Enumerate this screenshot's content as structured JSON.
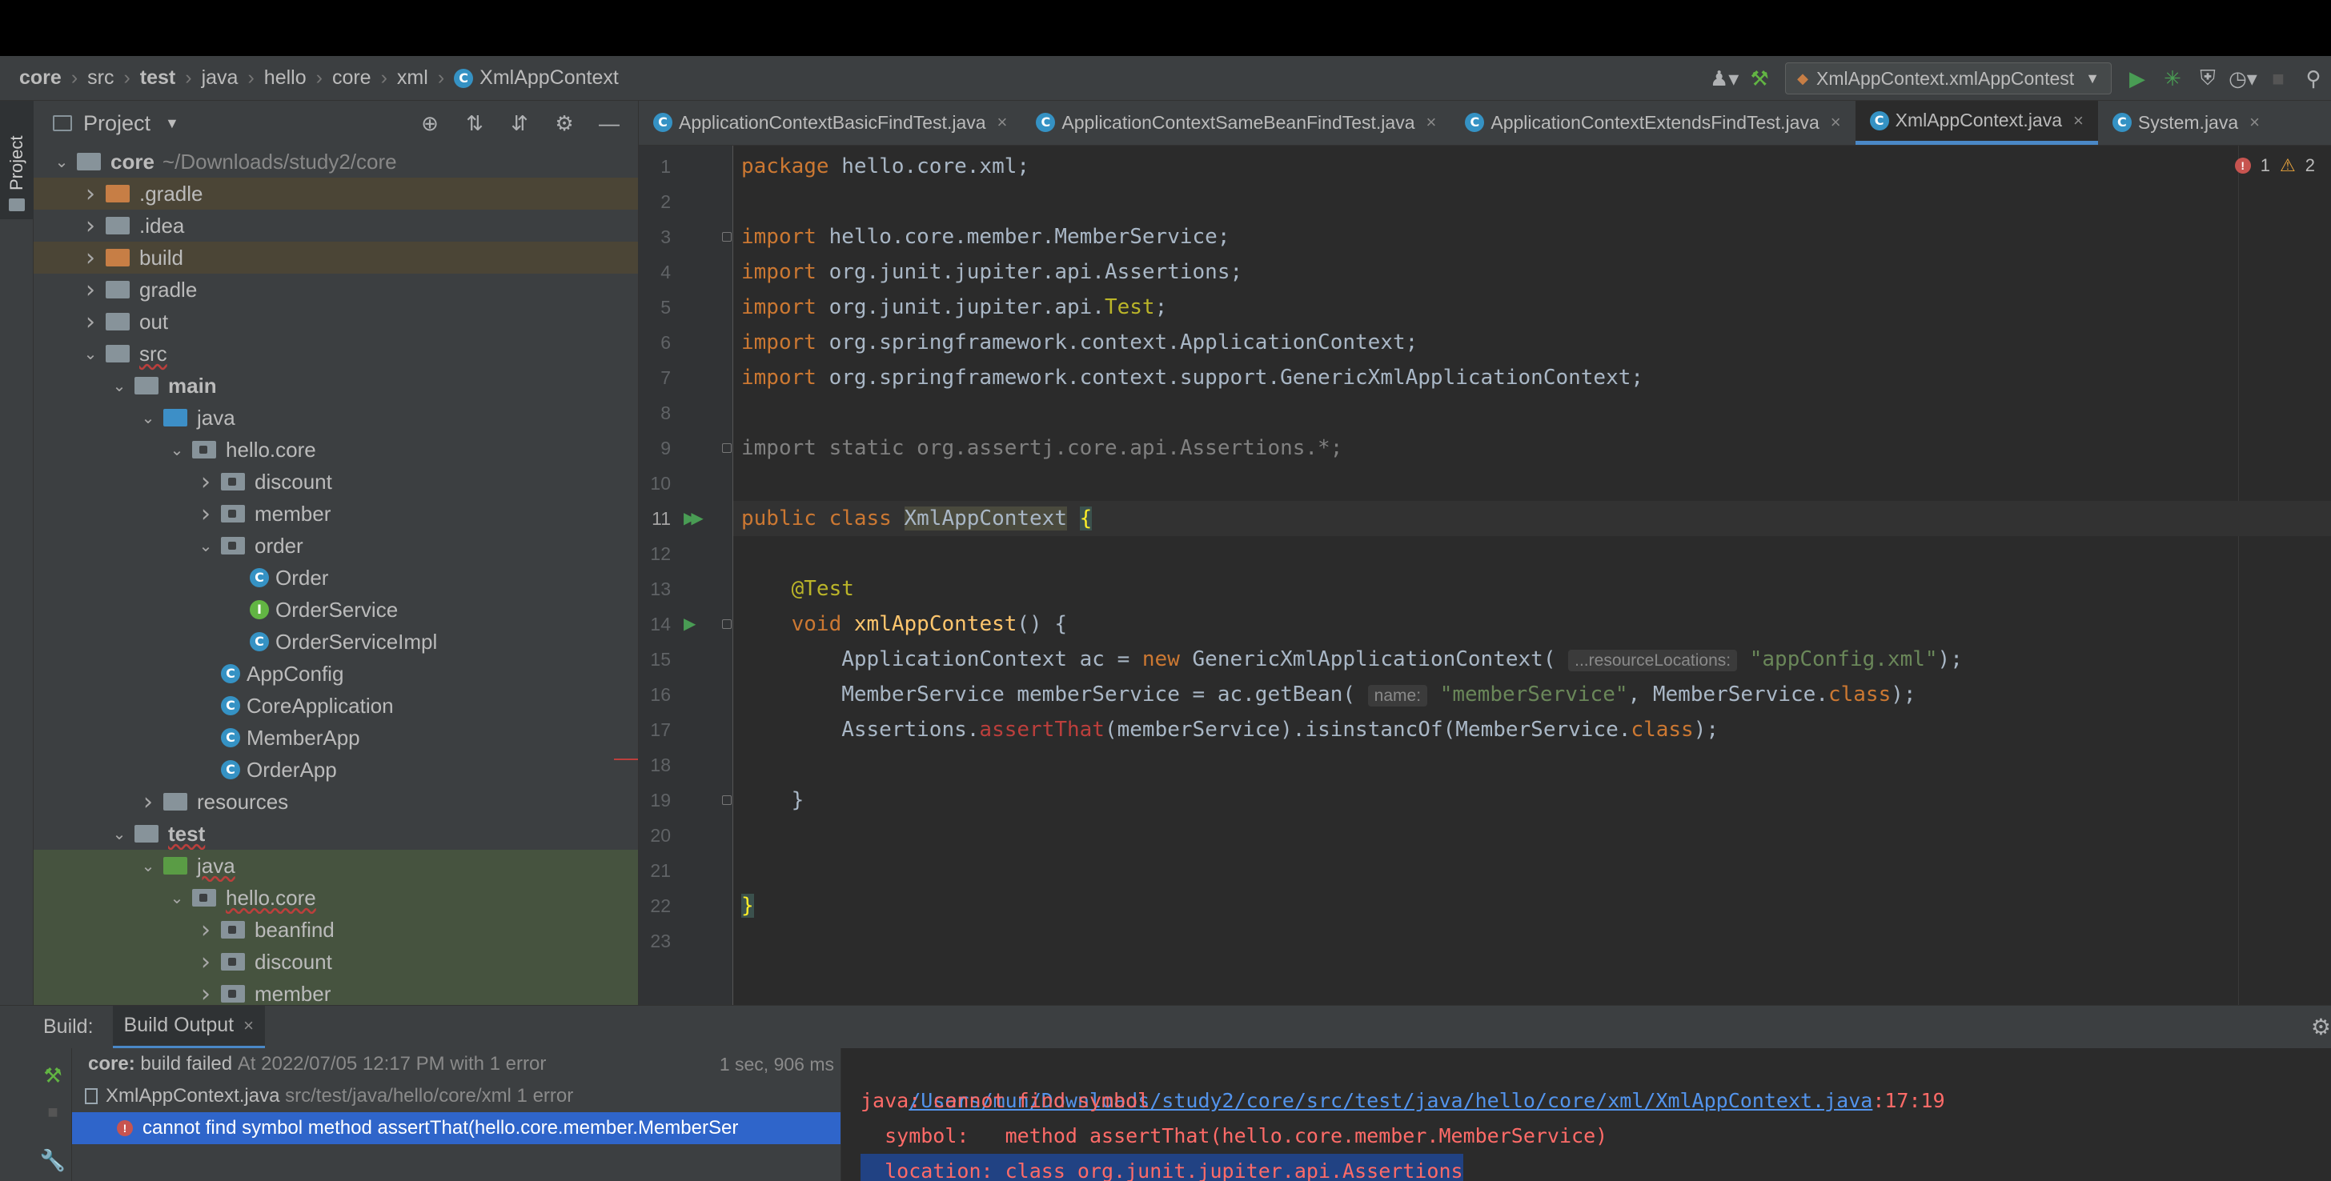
{
  "breadcrumb": {
    "items": [
      "core",
      "src",
      "test",
      "java",
      "hello",
      "core",
      "xml"
    ],
    "file": "XmlAppContext"
  },
  "toolbar": {
    "run_config": "XmlAppContext.xmlAppContest"
  },
  "project_panel": {
    "title": "Project",
    "stripe_label": "Project"
  },
  "tree": [
    {
      "label": "core",
      "sub": "~/Downloads/study2/core",
      "indent": 0,
      "arrow": "down",
      "icon": "grey",
      "bold": true
    },
    {
      "label": ".gradle",
      "indent": 1,
      "arrow": "right",
      "icon": "orange",
      "hl": "orange"
    },
    {
      "label": ".idea",
      "indent": 1,
      "arrow": "right",
      "icon": "grey"
    },
    {
      "label": "build",
      "indent": 1,
      "arrow": "right",
      "icon": "orange",
      "hl": "orange"
    },
    {
      "label": "gradle",
      "indent": 1,
      "arrow": "right",
      "icon": "grey"
    },
    {
      "label": "out",
      "indent": 1,
      "arrow": "right",
      "icon": "grey"
    },
    {
      "label": "src",
      "indent": 1,
      "arrow": "down",
      "icon": "grey",
      "err": true
    },
    {
      "label": "main",
      "indent": 2,
      "arrow": "down",
      "icon": "grey",
      "bold": true
    },
    {
      "label": "java",
      "indent": 3,
      "arrow": "down",
      "icon": "blue"
    },
    {
      "label": "hello.core",
      "indent": 4,
      "arrow": "down",
      "icon": "pkg"
    },
    {
      "label": "discount",
      "indent": 5,
      "arrow": "right",
      "icon": "pkg"
    },
    {
      "label": "member",
      "indent": 5,
      "arrow": "right",
      "icon": "pkg"
    },
    {
      "label": "order",
      "indent": 5,
      "arrow": "down",
      "icon": "pkg"
    },
    {
      "label": "Order",
      "indent": 6,
      "arrow": "",
      "icon": "class"
    },
    {
      "label": "OrderService",
      "indent": 6,
      "arrow": "",
      "icon": "interface"
    },
    {
      "label": "OrderServiceImpl",
      "indent": 6,
      "arrow": "",
      "icon": "class"
    },
    {
      "label": "AppConfig",
      "indent": 5,
      "arrow": "",
      "icon": "class"
    },
    {
      "label": "CoreApplication",
      "indent": 5,
      "arrow": "",
      "icon": "class"
    },
    {
      "label": "MemberApp",
      "indent": 5,
      "arrow": "",
      "icon": "class"
    },
    {
      "label": "OrderApp",
      "indent": 5,
      "arrow": "",
      "icon": "class"
    },
    {
      "label": "resources",
      "indent": 3,
      "arrow": "right",
      "icon": "grey"
    },
    {
      "label": "test",
      "indent": 2,
      "arrow": "down",
      "icon": "grey",
      "bold": true,
      "err": true
    },
    {
      "label": "java",
      "indent": 3,
      "arrow": "down",
      "icon": "green",
      "hl": "green",
      "err": true
    },
    {
      "label": "hello.core",
      "indent": 4,
      "arrow": "down",
      "icon": "pkg",
      "hl": "green",
      "err": true
    },
    {
      "label": "beanfind",
      "indent": 5,
      "arrow": "right",
      "icon": "pkg",
      "hl": "green"
    },
    {
      "label": "discount",
      "indent": 5,
      "arrow": "right",
      "icon": "pkg",
      "hl": "green"
    },
    {
      "label": "member",
      "indent": 5,
      "arrow": "right",
      "icon": "pkg",
      "hl": "green"
    }
  ],
  "tabs": [
    {
      "label": "ApplicationContextBasicFindTest.java",
      "active": false
    },
    {
      "label": "ApplicationContextSameBeanFindTest.java",
      "active": false
    },
    {
      "label": "ApplicationContextExtendsFindTest.java",
      "active": false
    },
    {
      "label": "XmlAppContext.java",
      "active": true
    },
    {
      "label": "System.java",
      "active": false
    }
  ],
  "inspections": {
    "errors": "1",
    "warnings": "2"
  },
  "code": [
    "<span class='kw'>package</span> hello.core.xml;",
    "",
    "<span class='kw'>import</span> hello.core.member.MemberService;",
    "<span class='kw'>import</span> org.junit.jupiter.api.Assertions;",
    "<span class='kw'>import</span> org.junit.jupiter.api.<span class='ann'>Test</span>;",
    "<span class='kw'>import</span> org.springframework.context.ApplicationContext;",
    "<span class='kw'>import</span> org.springframework.context.support.GenericXmlApplicationContext;",
    "",
    "<span class='grey'>import static org.assertj.core.api.Assertions.*;</span>",
    "",
    "<span class='kw'>public class</span> <span class='cls-hl'>XmlAppContext</span> <span class='brace-hl'>{</span>",
    "",
    "    <span class='ann'>@Test</span>",
    "    <span class='kw'>void</span> <span class='fn'>xmlAppContest</span>() {",
    "        ApplicationContext ac = <span class='kw'>new</span> GenericXmlApplicationContext( <span class='hint'>...resourceLocations:</span> <span class='str'>\"appConfig.xml\"</span>);",
    "        MemberService memberService = ac.getBean( <span class='hint'>name:</span> <span class='str'>\"memberService\"</span>, MemberService.<span class='kw'>class</span>);",
    "        Assertions.<span class='err'>assertThat</span>(memberService).isinstancOf(MemberService.<span class='kw'>class</span>);",
    "",
    "    }",
    "",
    "",
    "<span class='brace-hl'>}</span>",
    ""
  ],
  "build": {
    "label": "Build:",
    "tab": "Build Output",
    "rows": [
      {
        "title": "core:",
        "text": "build failed",
        "sub": "At 2022/07/05 12:17 PM with 1 error",
        "time": "1 sec, 906 ms"
      },
      {
        "title": "XmlAppContext.java",
        "sub": "src/test/java/hello/core/xml 1 error"
      },
      {
        "title": "cannot find symbol method assertThat(hello.core.member.MemberSer"
      }
    ],
    "console": {
      "path": "/Users/mun/Downloads/study2/core/src/test/java/hello/core/xml/XmlAppContext.java",
      "pos": ":17:19",
      "line2": "java: cannot find symbol",
      "line3": "  symbol:   method assertThat(hello.core.member.MemberService)",
      "line4": "  location: class org.junit.jupiter.api.Assertions"
    }
  }
}
